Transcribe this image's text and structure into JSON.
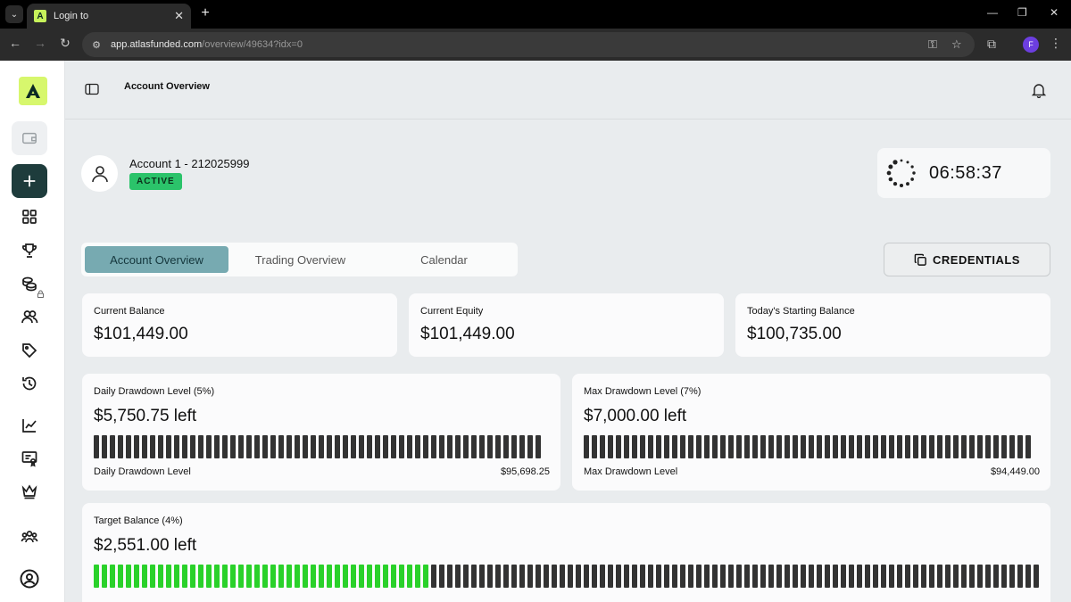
{
  "browser": {
    "tab_title": "Login to",
    "tab_favicon_letter": "A",
    "url_host": "app.atlasfunded.com",
    "url_path": "/overview/49634?idx=0",
    "profile_initial": "F"
  },
  "header": {
    "title": "Account Overview"
  },
  "account": {
    "name": "Account 1 - 212025999",
    "status": "ACTIVE",
    "status_color": "#2bc36a",
    "timer": "06:58:37"
  },
  "tabs": [
    {
      "label": "Account Overview",
      "active": true
    },
    {
      "label": "Trading Overview",
      "active": false
    },
    {
      "label": "Calendar",
      "active": false
    }
  ],
  "credentials_button": "CREDENTIALS",
  "stats": [
    {
      "label": "Current Balance",
      "value": "$101,449.00"
    },
    {
      "label": "Current Equity",
      "value": "$101,449.00"
    },
    {
      "label": "Today's Starting Balance",
      "value": "$100,735.00"
    }
  ],
  "daily_drawdown": {
    "label": "Daily Drawdown Level (5%)",
    "value": "$5,750.75 left",
    "footer_label": "Daily Drawdown Level",
    "footer_value": "$95,698.25",
    "filled_fraction": 0
  },
  "max_drawdown": {
    "label": "Max Drawdown Level (7%)",
    "value": "$7,000.00 left",
    "footer_label": "Max Drawdown Level",
    "footer_value": "$94,449.00",
    "filled_fraction": 0
  },
  "target": {
    "label": "Target Balance (4%)",
    "value": "$2,551.00 left",
    "progress_fraction": 0.36,
    "progress_color": "#2ad12a"
  },
  "colors": {
    "accent_dark": "#1e3c3c",
    "logo_bg": "#d7f76d",
    "tab_active": "#77aab1"
  },
  "icons": {
    "sidebar": [
      "wallet-icon",
      "plus-icon",
      "grid-icon",
      "trophy-icon",
      "coins-icon",
      "users-icon",
      "tag-icon",
      "history-icon",
      "chart-icon",
      "certificate-icon",
      "crown-icon",
      "community-icon",
      "account-icon"
    ]
  }
}
